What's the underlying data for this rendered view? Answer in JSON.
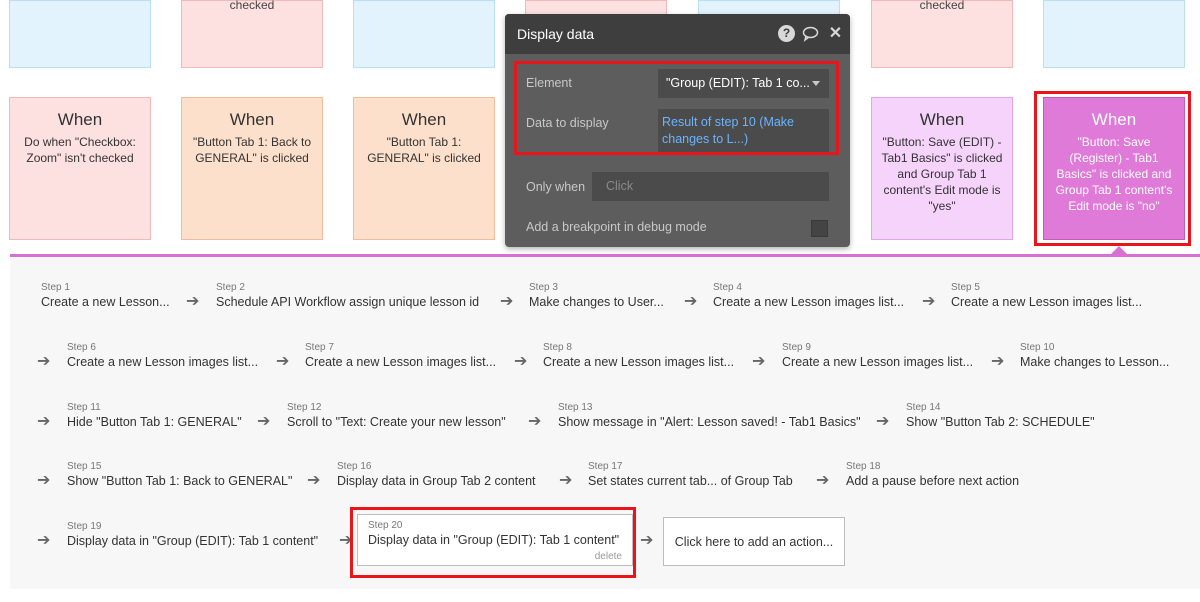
{
  "top_cards": [
    {
      "text": ""
    },
    {
      "text": "checked"
    },
    {
      "text": ""
    },
    {
      "text": ""
    },
    {
      "text": ""
    },
    {
      "text": "checked"
    },
    {
      "text": ""
    }
  ],
  "events": [
    {
      "when": "When",
      "desc": "Do when \"Checkbox: Zoom\" isn't checked"
    },
    {
      "when": "When",
      "desc": "\"Button Tab 1: Back to GENERAL\" is clicked"
    },
    {
      "when": "When",
      "desc": "\"Button Tab 1: GENERAL\" is clicked"
    },
    {
      "when": "When",
      "desc": "\"Button: Save (EDIT) - Tab1 Basics\" is clicked and Group Tab 1 content's Edit mode is \"yes\""
    },
    {
      "when": "When",
      "desc": "\"Button: Save (Register) - Tab1 Basics\" is clicked and Group Tab 1 content's Edit mode is \"no\""
    }
  ],
  "modal": {
    "title": "Display data",
    "help_icon": "?",
    "element_label": "Element",
    "element_value": "\"Group (EDIT): Tab 1 co...",
    "data_label": "Data to display",
    "data_value": "Result of step 10 (Make changes to L...)",
    "only_when_label": "Only when",
    "only_when_placeholder": "Click",
    "breakpoint_label": "Add a breakpoint in debug mode"
  },
  "steps": [
    {
      "num": "Step 1",
      "text": "Create a new Lesson..."
    },
    {
      "num": "Step 2",
      "text": "Schedule API Workflow assign unique lesson id"
    },
    {
      "num": "Step 3",
      "text": "Make changes to User..."
    },
    {
      "num": "Step 4",
      "text": "Create a new Lesson images list..."
    },
    {
      "num": "Step 5",
      "text": "Create a new Lesson images list..."
    },
    {
      "num": "Step 6",
      "text": "Create a new Lesson images list..."
    },
    {
      "num": "Step 7",
      "text": "Create a new Lesson images list..."
    },
    {
      "num": "Step 8",
      "text": "Create a new Lesson images list..."
    },
    {
      "num": "Step 9",
      "text": "Create a new Lesson images list..."
    },
    {
      "num": "Step 10",
      "text": "Make changes to Lesson..."
    },
    {
      "num": "Step 11",
      "text": "Hide \"Button Tab 1: GENERAL\""
    },
    {
      "num": "Step 12",
      "text": "Scroll to \"Text: Create your new lesson\""
    },
    {
      "num": "Step 13",
      "text": "Show message in \"Alert: Lesson saved! - Tab1 Basics\""
    },
    {
      "num": "Step 14",
      "text": "Show \"Button Tab 2: SCHEDULE\""
    },
    {
      "num": "Step 15",
      "text": "Show \"Button Tab 1: Back to GENERAL\""
    },
    {
      "num": "Step 16",
      "text": "Display data in Group Tab 2 content"
    },
    {
      "num": "Step 17",
      "text": "Set states current tab... of Group Tab"
    },
    {
      "num": "Step 18",
      "text": "Add a pause before next action"
    },
    {
      "num": "Step 19",
      "text": "Display data in \"Group (EDIT): Tab 1 content\""
    },
    {
      "num": "Step 20",
      "text": "Display data in \"Group (EDIT): Tab 1 content\"",
      "delete": "delete"
    }
  ],
  "add_action": "Click here to add an action..."
}
